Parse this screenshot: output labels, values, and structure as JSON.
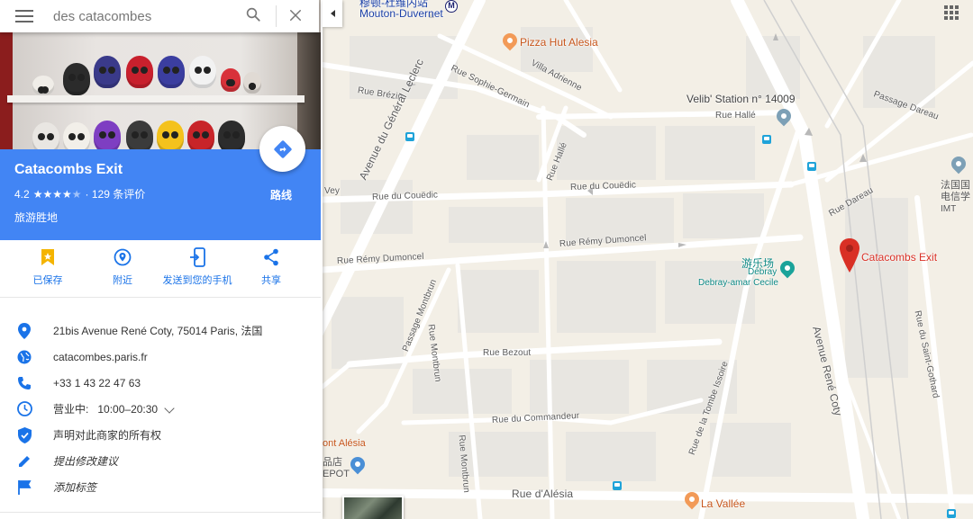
{
  "search": {
    "value": "des catacombes"
  },
  "place": {
    "name": "Catacombs Exit",
    "rating": "4.2",
    "stars_filled": 4,
    "stars_total": 5,
    "reviews": "· 129 条评价",
    "category": "旅游胜地",
    "directions_label": "路线"
  },
  "actions": [
    {
      "label": "已保存",
      "icon": "bookmark-icon"
    },
    {
      "label": "附近",
      "icon": "nearby-icon"
    },
    {
      "label": "发送到您的手机",
      "icon": "send-to-phone-icon"
    },
    {
      "label": "共享",
      "icon": "share-icon"
    }
  ],
  "info": {
    "address": "21bis Avenue René Coty, 75014 Paris, 法国",
    "website": "catacombes.paris.fr",
    "phone": "+33 1 43 22 47 63",
    "hours_status": "营业中:",
    "hours": "10:00–20:30",
    "claim": "声明对此商家的所有权",
    "suggest_edit": "提出修改建议",
    "add_label": "添加标签"
  },
  "map": {
    "streets": {
      "general_leclerc": "Avenue du Général Leclerc",
      "brezin": "Rue Brézin",
      "sophie_germain": "Rue Sophie-Germain",
      "villa_adrienne": "Villa Adrienne",
      "halle_v": "Rue Hallé",
      "halle_h": "Rue Hallé",
      "couedic_1": "Rue du Couëdic",
      "couedic_2": "Rue du Couëdic",
      "vey": "Vey",
      "remy_1": "Rue Rémy Dumoncel",
      "remy_2": "Rue Rémy Dumoncel",
      "passage_montbrun": "Passage Montbrun",
      "rue_montbrun": "Rue Montbrun",
      "bezout": "Rue Bezout",
      "commandeur": "Rue du Commandeur",
      "tombe_issoire": "Rue de la Tombe Issoire",
      "rene_coty": "Avenue René Coty",
      "alesia": "Rue d'Alésia",
      "passage_dareau": "Passage Dareau",
      "rue_dareau": "Rue Dareau",
      "saint_gothard": "Rue du Saint-Gothard"
    },
    "pois": {
      "metro_cn": "穆顿-杜维内站",
      "metro": "Mouton-Duvernet",
      "metro_badge": "M",
      "pizza": "Pizza Hut Alesia",
      "velib": "Velib' Station n° 14009",
      "park_cn": "游乐场",
      "park_1": "Debray",
      "park_2": "Debray-amar Cecile",
      "marker": "Catacombs Exit",
      "institute_1": "法国国",
      "institute_2": "电信学",
      "institute_3": "IMT",
      "alesia_edge": "ont Alésia",
      "shop_1": "品店",
      "shop_2": "EPOT",
      "vallee": "La Vallée"
    },
    "colors": {
      "accent": "#4285f4",
      "marker": "#d93025",
      "park": "#0f8a86",
      "food": "#f29a57"
    }
  }
}
